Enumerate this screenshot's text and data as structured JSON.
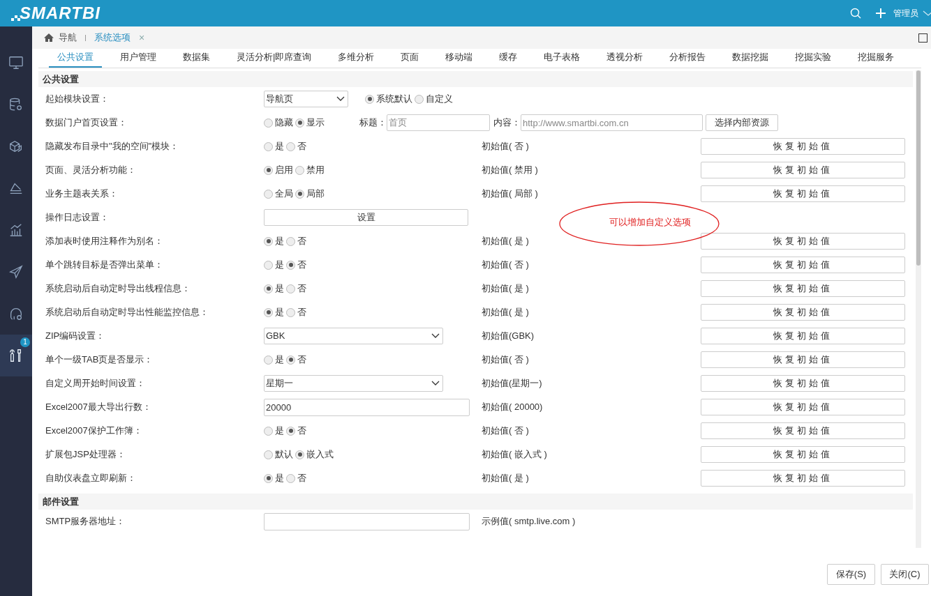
{
  "header": {
    "logo": "SMARTBI",
    "user": "管理员"
  },
  "sidebar": {
    "items": [
      {
        "kind": "monitor",
        "selected": false
      },
      {
        "kind": "database",
        "selected": false
      },
      {
        "kind": "cube",
        "selected": false
      },
      {
        "kind": "tray",
        "selected": false
      },
      {
        "kind": "chart",
        "selected": false
      },
      {
        "kind": "plane",
        "selected": false
      },
      {
        "kind": "headset",
        "selected": false
      },
      {
        "kind": "tools",
        "selected": true,
        "badge": "1"
      }
    ]
  },
  "breadcrumb": {
    "home": "导航",
    "tab": "系统选项",
    "close": "×"
  },
  "tabs": [
    {
      "label": "公共设置",
      "selected": true
    },
    {
      "label": "用户管理",
      "selected": false
    },
    {
      "label": "数据集",
      "selected": false
    },
    {
      "label": "灵活分析|即席查询",
      "selected": false
    },
    {
      "label": "多维分析",
      "selected": false
    },
    {
      "label": "页面",
      "selected": false
    },
    {
      "label": "移动端",
      "selected": false
    },
    {
      "label": "缓存",
      "selected": false
    },
    {
      "label": "电子表格",
      "selected": false
    },
    {
      "label": "透视分析",
      "selected": false
    },
    {
      "label": "分析报告",
      "selected": false
    },
    {
      "label": "数据挖掘",
      "selected": false
    },
    {
      "label": "挖掘实验",
      "selected": false
    },
    {
      "label": "挖掘服务",
      "selected": false
    }
  ],
  "sections": [
    {
      "title": "公共设置",
      "rows": [
        {
          "kind": "select",
          "label": "起始模块设置：",
          "value": "导航页",
          "radios": [
            {
              "label": "系统默认",
              "selected": true
            },
            {
              "label": "自定义",
              "selected": false
            }
          ]
        },
        {
          "kind": "portal",
          "label": "数据门户首页设置：",
          "radios": [
            {
              "label": "隐藏",
              "selected": false
            },
            {
              "label": "显示",
              "selected": true
            }
          ],
          "fields": [
            {
              "label": "标题：",
              "value": "首页"
            },
            {
              "label": "内容：",
              "value": "http://www.smartbi.com.cn"
            }
          ],
          "button": "选择内部资源"
        },
        {
          "kind": "radio",
          "label": "隐藏发布目录中\"我的空间\"模块：",
          "radios": [
            {
              "label": "是",
              "selected": false
            },
            {
              "label": "否",
              "selected": false
            }
          ],
          "initial": "初始值( 否 )",
          "reset": "恢复初始值"
        },
        {
          "kind": "radio",
          "label": "页面、灵活分析功能：",
          "radios": [
            {
              "label": "启用",
              "selected": true
            },
            {
              "label": "禁用",
              "selected": false
            }
          ],
          "initial": "初始值( 禁用 )",
          "reset": "恢复初始值"
        },
        {
          "kind": "radio",
          "label": "业务主题表关系：",
          "radios": [
            {
              "label": "全局",
              "selected": false
            },
            {
              "label": "局部",
              "selected": true
            }
          ],
          "initial": "初始值( 局部 )",
          "reset": "恢复初始值"
        },
        {
          "kind": "button",
          "label": "操作日志设置：",
          "button": "设置"
        },
        {
          "kind": "radio",
          "label": "添加表时使用注释作为别名：",
          "radios": [
            {
              "label": "是",
              "selected": true
            },
            {
              "label": "否",
              "selected": false
            }
          ],
          "initial": "初始值( 是 )",
          "reset": "恢复初始值"
        },
        {
          "kind": "radio",
          "label": "单个跳转目标是否弹出菜单：",
          "radios": [
            {
              "label": "是",
              "selected": false
            },
            {
              "label": "否",
              "selected": true
            }
          ],
          "initial": "初始值( 否 )",
          "reset": "恢复初始值"
        },
        {
          "kind": "radio",
          "label": "系统启动后自动定时导出线程信息：",
          "radios": [
            {
              "label": "是",
              "selected": true
            },
            {
              "label": "否",
              "selected": false
            }
          ],
          "initial": "初始值( 是 )",
          "reset": "恢复初始值"
        },
        {
          "kind": "radio",
          "label": "系统启动后自动定时导出性能监控信息：",
          "radios": [
            {
              "label": "是",
              "selected": true
            },
            {
              "label": "否",
              "selected": false
            }
          ],
          "initial": "初始值( 是 )",
          "reset": "恢复初始值"
        },
        {
          "kind": "select",
          "label": "ZIP编码设置：",
          "value": "GBK",
          "initial": "初始值(GBK)",
          "reset": "恢复初始值"
        },
        {
          "kind": "radio",
          "label": "单个一级TAB页是否显示：",
          "radios": [
            {
              "label": "是",
              "selected": false
            },
            {
              "label": "否",
              "selected": true
            }
          ],
          "initial": "初始值( 否 )",
          "reset": "恢复初始值"
        },
        {
          "kind": "select",
          "label": "自定义周开始时间设置：",
          "value": "星期一",
          "initial": "初始值(星期一)",
          "reset": "恢复初始值"
        },
        {
          "kind": "input",
          "label": "Excel2007最大导出行数：",
          "value": "20000",
          "initial": "初始值( 20000)",
          "reset": "恢复初始值"
        },
        {
          "kind": "radio",
          "label": "Excel2007保护工作簿：",
          "radios": [
            {
              "label": "是",
              "selected": false
            },
            {
              "label": "否",
              "selected": true
            }
          ],
          "initial": "初始值( 否 )",
          "reset": "恢复初始值"
        },
        {
          "kind": "radio",
          "label": "扩展包JSP处理器：",
          "radios": [
            {
              "label": "默认",
              "selected": false
            },
            {
              "label": "嵌入式",
              "selected": true
            }
          ],
          "initial": "初始值( 嵌入式 )",
          "reset": "恢复初始值"
        },
        {
          "kind": "radio",
          "label": "自助仪表盘立即刷新：",
          "radios": [
            {
              "label": "是",
              "selected": true
            },
            {
              "label": "否",
              "selected": false
            }
          ],
          "initial": "初始值( 是 )",
          "reset": "恢复初始值"
        }
      ]
    },
    {
      "title": "邮件设置",
      "rows": [
        {
          "kind": "input",
          "label": "SMTP服务器地址：",
          "initial": "示例值( smtp.live.com )"
        }
      ]
    }
  ],
  "annotation": {
    "text": "可以增加自定义选项"
  },
  "footer": {
    "buttons": [
      "保存(S)",
      "关闭(C)"
    ]
  }
}
